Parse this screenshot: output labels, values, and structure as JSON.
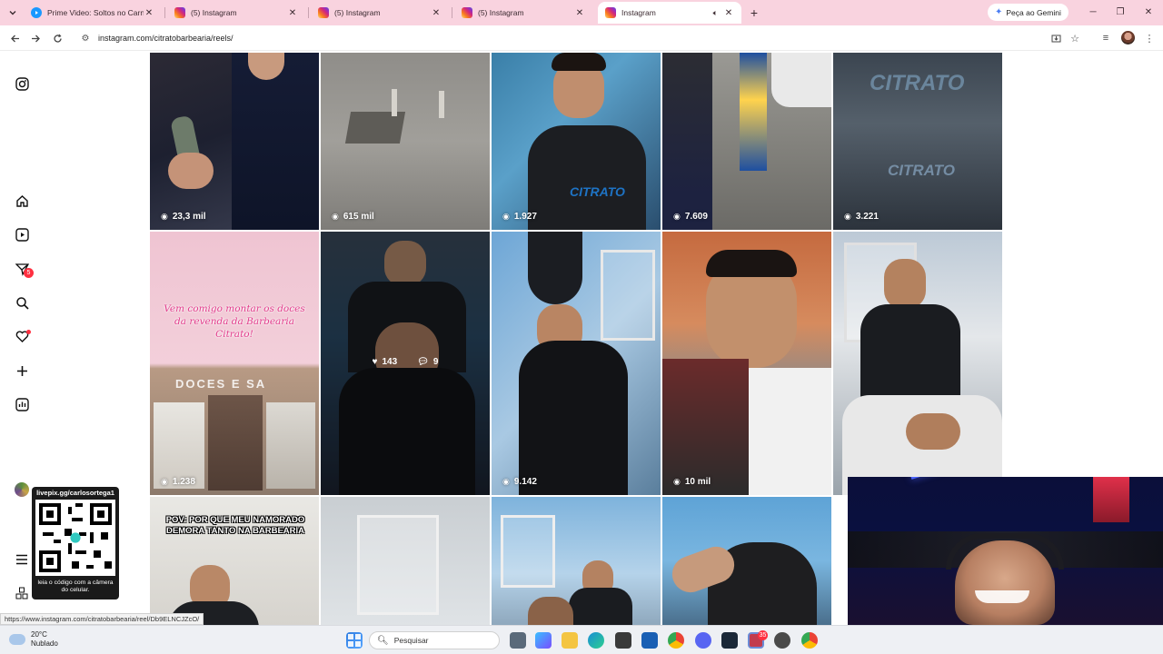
{
  "browser": {
    "tabs": [
      {
        "title": "Prime Video: Soltos no Carnava",
        "favicon": "prime-video-icon",
        "active": false
      },
      {
        "title": "(5) Instagram",
        "favicon": "instagram-icon",
        "active": false
      },
      {
        "title": "(5) Instagram",
        "favicon": "instagram-icon",
        "active": false
      },
      {
        "title": "(5) Instagram",
        "favicon": "instagram-icon",
        "active": false
      },
      {
        "title": "Instagram",
        "favicon": "instagram-icon",
        "active": true,
        "audio": true
      }
    ],
    "gemini_label": "Peça ao Gemini",
    "url": "instagram.com/citratobarbearia/reels/",
    "status_url": "https://www.instagram.com/citratobarbearia/reel/Db9ELNCJZcO/"
  },
  "sidebar": {
    "notifications_badge": "5"
  },
  "reels": {
    "row1": [
      {
        "views": "23,3 mil"
      },
      {
        "views": "615 mil"
      },
      {
        "views": "1.927"
      },
      {
        "views": "7.609"
      },
      {
        "views": "3.221"
      }
    ],
    "row2": [
      {
        "views": "1.238",
        "caption": "Vem comigo montar os doces da revenda da Barbearia Citrato!"
      },
      {
        "likes": "143",
        "comments": "9",
        "hovered": true
      },
      {
        "views": "9.142"
      },
      {
        "views": "10 mil"
      },
      {
        "views": ""
      }
    ],
    "row3": [
      {
        "caption": "POV: POR QUE MEU NAMORADO DEMORA TANTO NA BARBEARIA"
      },
      {},
      {},
      {}
    ],
    "brand_text": "CITRATO",
    "shop_sign": "DOCES E SA"
  },
  "qr_overlay": {
    "top_text": "livepix.gg/carlosortega1",
    "bottom_text": "leia o código com a câmera do celular."
  },
  "taskbar": {
    "temperature": "20°C",
    "weather": "Nublado",
    "search_placeholder": "Pesquisar",
    "notification_badge": "35"
  },
  "colors": {
    "tabstrip": "#f9d3df",
    "instagram_red": "#ff3040",
    "caption_pink": "#e23c8b"
  }
}
